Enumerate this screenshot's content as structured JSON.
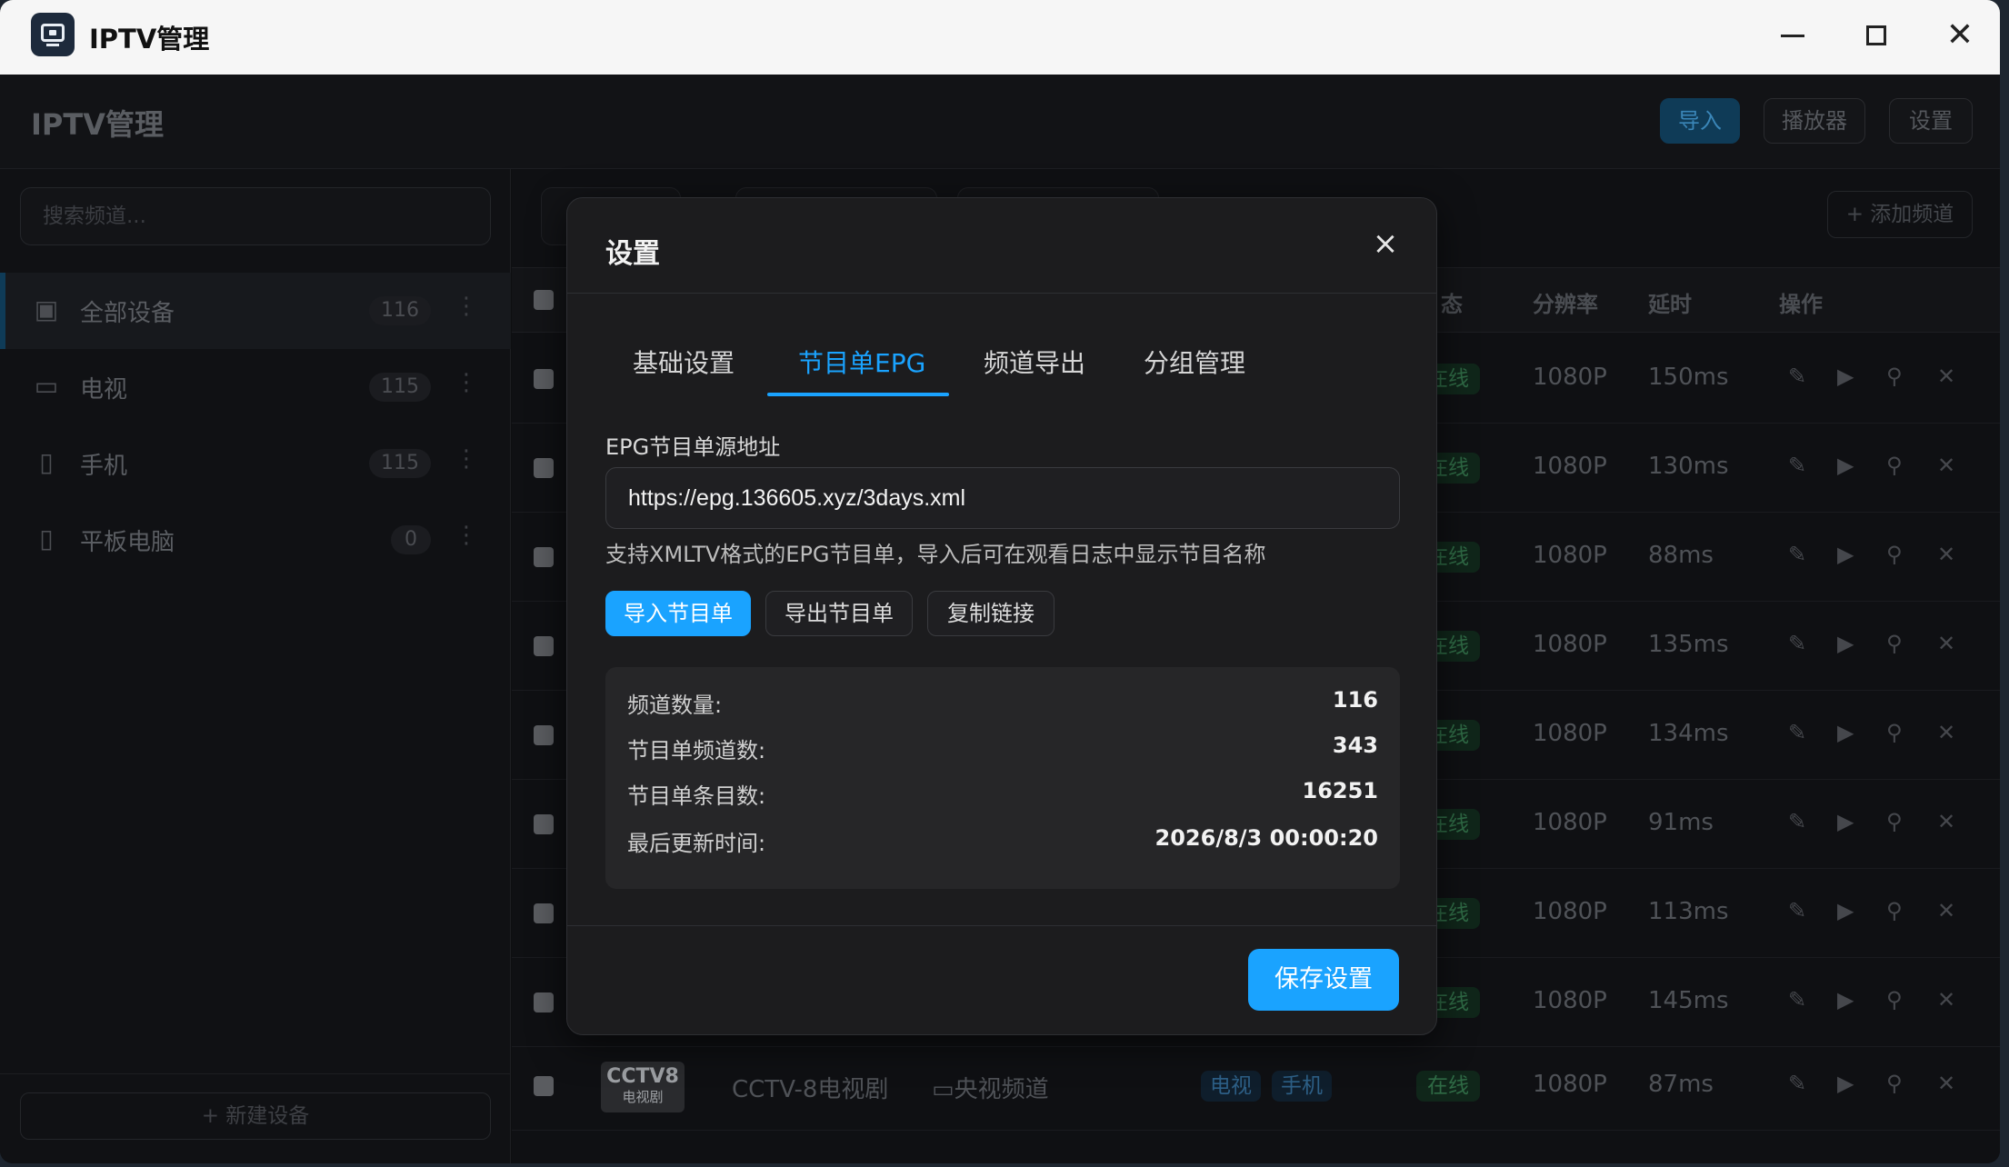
{
  "window": {
    "title": "IPTV管理"
  },
  "header": {
    "app_name": "IPTV管理",
    "import_label": "导入",
    "player_label": "播放器",
    "settings_label": "设置"
  },
  "sidebar": {
    "search_placeholder": "搜索频道...",
    "devices": [
      {
        "label": "全部设备",
        "count": "116",
        "icon": "folder-icon"
      },
      {
        "label": "电视",
        "count": "115",
        "icon": "tv-icon"
      },
      {
        "label": "手机",
        "count": "115",
        "icon": "phone-icon"
      },
      {
        "label": "平板电脑",
        "count": "0",
        "icon": "tablet-icon"
      }
    ],
    "new_device_label": "+ 新建设备"
  },
  "main": {
    "add_channel_label": "+ 添加频道",
    "columns": {
      "status": "态",
      "resolution": "分辨率",
      "latency": "延时",
      "actions": "操作"
    },
    "rows": [
      {
        "status": "在线",
        "resolution": "1080P",
        "latency": "150ms"
      },
      {
        "status": "在线",
        "resolution": "1080P",
        "latency": "130ms"
      },
      {
        "status": "在线",
        "resolution": "1080P",
        "latency": "88ms"
      },
      {
        "status": "在线",
        "resolution": "1080P",
        "latency": "135ms"
      },
      {
        "status": "在线",
        "resolution": "1080P",
        "latency": "134ms"
      },
      {
        "status": "在线",
        "resolution": "1080P",
        "latency": "91ms"
      },
      {
        "status": "在线",
        "resolution": "1080P",
        "latency": "113ms"
      },
      {
        "status": "在线",
        "resolution": "1080P",
        "latency": "145ms"
      }
    ],
    "last_row": {
      "logo_top": "CCTV8",
      "logo_bottom": "电视剧",
      "name": "CCTV-8电视剧",
      "group": "央视频道",
      "tags": [
        "电视",
        "手机"
      ],
      "status": "在线",
      "resolution": "1080P",
      "latency": "87ms"
    }
  },
  "modal": {
    "title": "设置",
    "tabs": [
      "基础设置",
      "节目单EPG",
      "频道导出",
      "分组管理"
    ],
    "active_tab": "节目单EPG",
    "epg_label": "EPG节目单源地址",
    "epg_url": "https://epg.136605.xyz/3days.xml",
    "hint": "支持XMLTV格式的EPG节目单，导入后可在观看日志中显示节目名称",
    "buttons": {
      "import": "导入节目单",
      "export": "导出节目单",
      "copy": "复制链接"
    },
    "stats": [
      {
        "label": "频道数量:",
        "value": "116"
      },
      {
        "label": "节目单频道数:",
        "value": "343"
      },
      {
        "label": "节目单条目数:",
        "value": "16251"
      },
      {
        "label": "最后更新时间:",
        "value": "2026/8/3 00:00:20"
      }
    ],
    "save_label": "保存设置"
  },
  "colors": {
    "accent": "#1aa3ff",
    "online": "#2f6a45"
  }
}
